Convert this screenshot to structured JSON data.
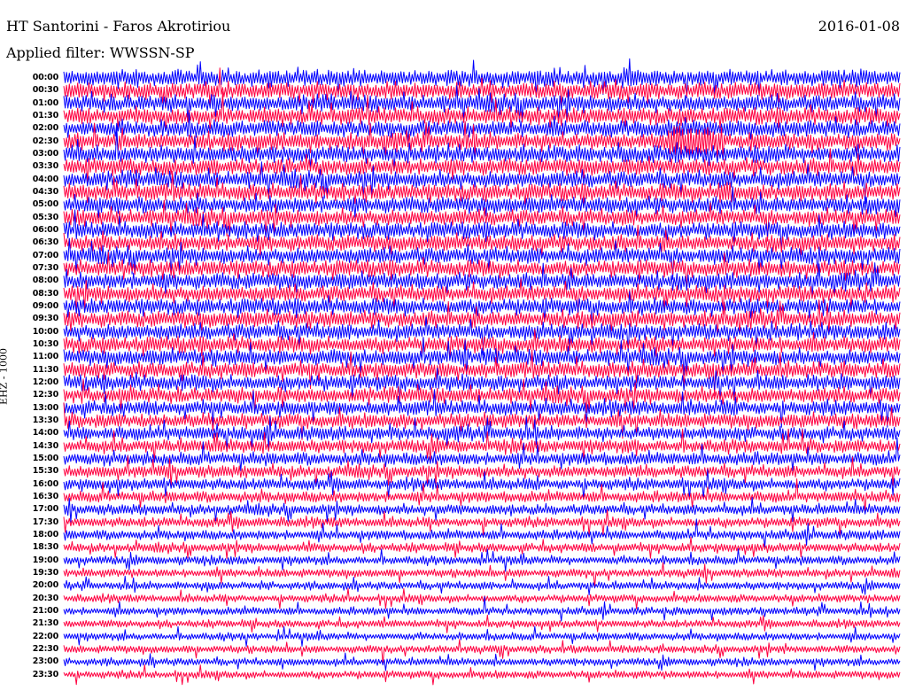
{
  "header": {
    "station": "HT Santorini - Faros Akrotiriou",
    "date": "2016-01-08",
    "filter": "Applied filter: WWSSN-SP"
  },
  "channel": "EHZ - 1000",
  "colors": {
    "trace_a": "#0000ff",
    "trace_b": "#ff0040",
    "background": "#ffffff",
    "text": "#000000"
  },
  "chart_data": {
    "type": "line",
    "series_colors_alternate": [
      "#0000ff",
      "#ff0040"
    ],
    "rows": [
      {
        "time": "00:00",
        "activity": 0.95
      },
      {
        "time": "00:30",
        "activity": 0.95
      },
      {
        "time": "01:00",
        "activity": 0.95
      },
      {
        "time": "01:30",
        "activity": 0.95
      },
      {
        "time": "02:00",
        "activity": 0.95
      },
      {
        "time": "02:30",
        "activity": 0.95
      },
      {
        "time": "03:00",
        "activity": 0.95
      },
      {
        "time": "03:30",
        "activity": 0.95
      },
      {
        "time": "04:00",
        "activity": 0.95
      },
      {
        "time": "04:30",
        "activity": 0.95
      },
      {
        "time": "05:00",
        "activity": 0.92
      },
      {
        "time": "05:30",
        "activity": 0.92
      },
      {
        "time": "06:00",
        "activity": 0.92
      },
      {
        "time": "06:30",
        "activity": 0.92
      },
      {
        "time": "07:00",
        "activity": 0.92
      },
      {
        "time": "07:30",
        "activity": 0.92
      },
      {
        "time": "08:00",
        "activity": 0.92
      },
      {
        "time": "08:30",
        "activity": 0.92
      },
      {
        "time": "09:00",
        "activity": 0.9
      },
      {
        "time": "09:30",
        "activity": 0.9
      },
      {
        "time": "10:00",
        "activity": 0.9
      },
      {
        "time": "10:30",
        "activity": 0.9
      },
      {
        "time": "11:00",
        "activity": 0.88
      },
      {
        "time": "11:30",
        "activity": 0.88
      },
      {
        "time": "12:00",
        "activity": 0.86
      },
      {
        "time": "12:30",
        "activity": 0.84
      },
      {
        "time": "13:00",
        "activity": 0.8
      },
      {
        "time": "13:30",
        "activity": 0.76
      },
      {
        "time": "14:00",
        "activity": 0.72
      },
      {
        "time": "14:30",
        "activity": 0.68
      },
      {
        "time": "15:00",
        "activity": 0.64
      },
      {
        "time": "15:30",
        "activity": 0.6
      },
      {
        "time": "16:00",
        "activity": 0.55
      },
      {
        "time": "16:30",
        "activity": 0.5
      },
      {
        "time": "17:00",
        "activity": 0.46
      },
      {
        "time": "17:30",
        "activity": 0.42
      },
      {
        "time": "18:00",
        "activity": 0.4
      },
      {
        "time": "18:30",
        "activity": 0.36
      },
      {
        "time": "19:00",
        "activity": 0.33
      },
      {
        "time": "19:30",
        "activity": 0.3
      },
      {
        "time": "20:00",
        "activity": 0.28
      },
      {
        "time": "20:30",
        "activity": 0.26
      },
      {
        "time": "21:00",
        "activity": 0.26
      },
      {
        "time": "21:30",
        "activity": 0.25
      },
      {
        "time": "22:00",
        "activity": 0.25
      },
      {
        "time": "22:30",
        "activity": 0.25
      },
      {
        "time": "23:00",
        "activity": 0.25
      },
      {
        "time": "23:30",
        "activity": 0.25
      }
    ],
    "events": [
      {
        "time": "02:30",
        "x_fraction": 0.72,
        "width_fraction": 0.07,
        "strength": 1.0
      },
      {
        "time": "04:30",
        "x_fraction": 0.78,
        "width_fraction": 0.03,
        "strength": 0.6
      }
    ],
    "grid": false,
    "legend": "none"
  }
}
